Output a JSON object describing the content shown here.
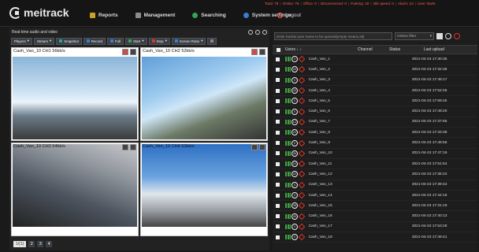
{
  "brand": {
    "name": "meitrack"
  },
  "nav": [
    {
      "label": "Reports",
      "color": "#c9a227"
    },
    {
      "label": "Management",
      "color": "#8c8c8c"
    },
    {
      "label": "Searching",
      "color": "#35a35a"
    },
    {
      "label": "System settings",
      "color": "#3a7bd5"
    }
  ],
  "logout_label": "Logout",
  "status_strip": [
    "Total: 78",
    "Online: 78",
    "Office: 0",
    "Disconnected: 0",
    "Parking: 18",
    "Idle speed: 0",
    "Alarm: 24",
    "User: Bank"
  ],
  "left_panel": {
    "title": "Real-time audio and video",
    "toolbar": [
      {
        "label": "Players",
        "style": "plain"
      },
      {
        "label": "Stream",
        "style": "plain"
      },
      {
        "label": "Snapshot",
        "style": "teal"
      },
      {
        "label": "Record",
        "style": "blue"
      },
      {
        "label": "Full",
        "style": "blue"
      },
      {
        "label": "Start",
        "style": "green"
      },
      {
        "label": "Stop",
        "style": "red"
      },
      {
        "label": "Screen Ratio",
        "style": "blue"
      }
    ],
    "videos": [
      {
        "label": "Cash_Van_10  CH1  56kb/s"
      },
      {
        "label": "Cash_Van_10  CH2  52kb/s"
      },
      {
        "label": "Cash_Van_10  CH3  54kb/s"
      },
      {
        "label": "Cash_Van_10  CH4  53kb/s"
      }
    ],
    "pager": {
      "current": "1/(1)",
      "pages": [
        "2",
        "3",
        "4"
      ]
    }
  },
  "right_panel": {
    "search_placeholder": "Enter tracker,user name to be queried(empty means all)",
    "filter_label": "Online filter",
    "columns": {
      "users": "Users",
      "channel": "Channel",
      "status": "Status",
      "upload": "Last upload"
    },
    "rows": [
      {
        "name": "Cash_Van_1",
        "speed": "0",
        "date": "2021-04-23  17:30:35"
      },
      {
        "name": "Cash_Van_2",
        "speed": "40",
        "date": "2021-04-23  17:32:36"
      },
      {
        "name": "Cash_Van_3",
        "speed": "0",
        "date": "2021-04-23  17:45:17"
      },
      {
        "name": "Cash_Van_4",
        "speed": "40",
        "date": "2021-04-23  17:52:26"
      },
      {
        "name": "Cash_Van_5",
        "speed": "0",
        "date": "2021-04-23  17:58:45"
      },
      {
        "name": "Cash_Van_6",
        "speed": "0",
        "date": "2021-04-23  17:49:20"
      },
      {
        "name": "Cash_Van_7",
        "speed": "12",
        "date": "2021-04-23  17:37:55"
      },
      {
        "name": "Cash_Van_8",
        "speed": "24",
        "date": "2021-04-23  17:33:38"
      },
      {
        "name": "Cash_Van_9",
        "speed": "0",
        "date": "2021-04-23  17:46:56"
      },
      {
        "name": "Cash_Van_10",
        "speed": "36",
        "date": "2021-04-23  17:47:19"
      },
      {
        "name": "Cash_Van_11",
        "speed": "24",
        "date": "2021-04-23  17:51:54"
      },
      {
        "name": "Cash_Van_12",
        "speed": "40",
        "date": "2021-04-23  17:36:22"
      },
      {
        "name": "Cash_Van_13",
        "speed": "0",
        "date": "2021-04-23  17:39:42"
      },
      {
        "name": "Cash_Van_14",
        "speed": "0",
        "date": "2021-04-23  17:44:16"
      },
      {
        "name": "Cash_Van_15",
        "speed": "38",
        "date": "2021-04-23  17:31:19"
      },
      {
        "name": "Cash_Van_16",
        "speed": "40",
        "date": "2021-04-23  17:40:13"
      },
      {
        "name": "Cash_Van_17",
        "speed": "0",
        "date": "2021-04-23  17:53:28"
      },
      {
        "name": "Cash_Van_18",
        "speed": "0",
        "date": "2021-04-23  17:49:41"
      }
    ]
  }
}
